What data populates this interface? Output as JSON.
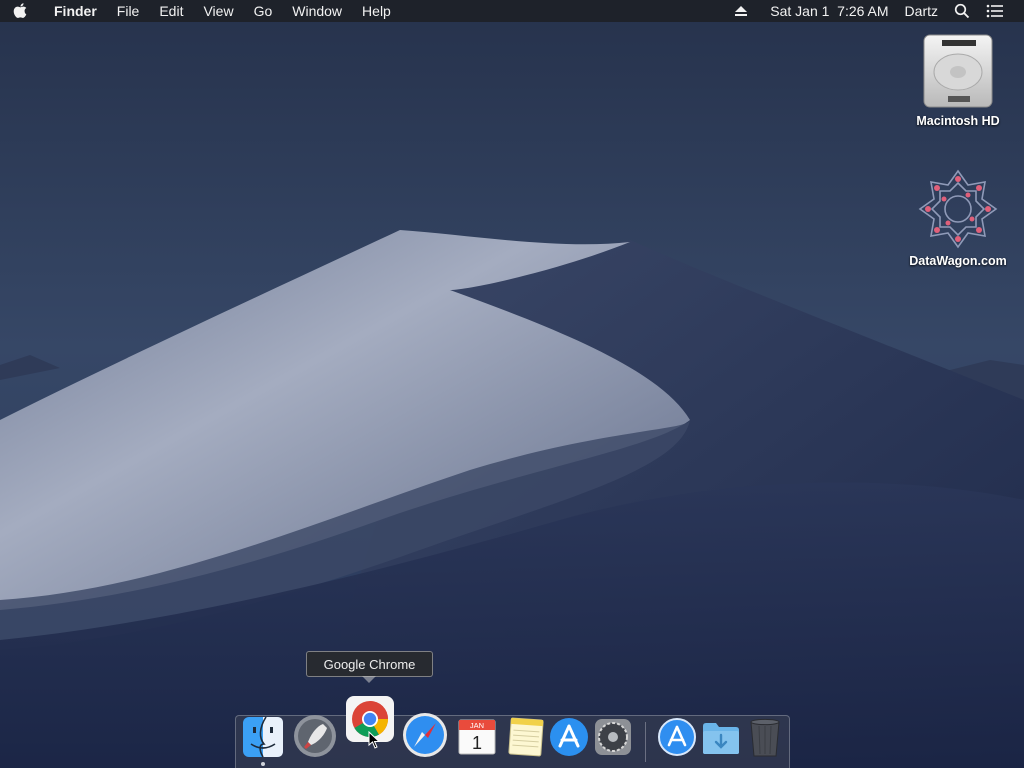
{
  "menubar": {
    "app_name": "Finder",
    "menus": [
      "File",
      "Edit",
      "View",
      "Go",
      "Window",
      "Help"
    ],
    "datetime": "Sat Jan 1  7:26 AM",
    "user": "Dartz",
    "icons": [
      "apple-icon",
      "eject-icon",
      "spotlight-search-icon",
      "notification-center-icon"
    ]
  },
  "desktop": {
    "icons": [
      {
        "label": "Macintosh HD",
        "icon": "hard-drive-icon"
      },
      {
        "label": "DataWagon.com",
        "icon": "datawagon-disk-icon"
      }
    ]
  },
  "tooltip": {
    "text": "Google Chrome"
  },
  "dock": {
    "items": [
      {
        "name": "Finder",
        "icon": "finder-icon",
        "running": true
      },
      {
        "name": "Launchpad",
        "icon": "launchpad-icon",
        "running": false
      },
      {
        "name": "Google Chrome",
        "icon": "chrome-icon",
        "running": false,
        "hovered": true
      },
      {
        "name": "Safari",
        "icon": "safari-icon",
        "running": false
      },
      {
        "name": "Calendar",
        "icon": "calendar-icon",
        "running": false,
        "month": "JAN",
        "day": "1"
      },
      {
        "name": "Notes",
        "icon": "notes-icon",
        "running": false
      },
      {
        "name": "App Store",
        "icon": "app-store-icon",
        "running": false
      },
      {
        "name": "System Preferences",
        "icon": "system-preferences-icon",
        "running": false
      },
      {
        "name": "Applications",
        "icon": "applications-folder-icon",
        "running": false
      },
      {
        "name": "Downloads",
        "icon": "downloads-folder-icon",
        "running": false
      },
      {
        "name": "Trash",
        "icon": "trash-icon",
        "running": false
      }
    ]
  },
  "colors": {
    "menubar_bg": "#1e2026",
    "sky_top": "#2b3a58",
    "sky_bottom": "#3a4d6e",
    "dune_light": "#9aa3b8",
    "dune_dark": "#1c2644"
  }
}
